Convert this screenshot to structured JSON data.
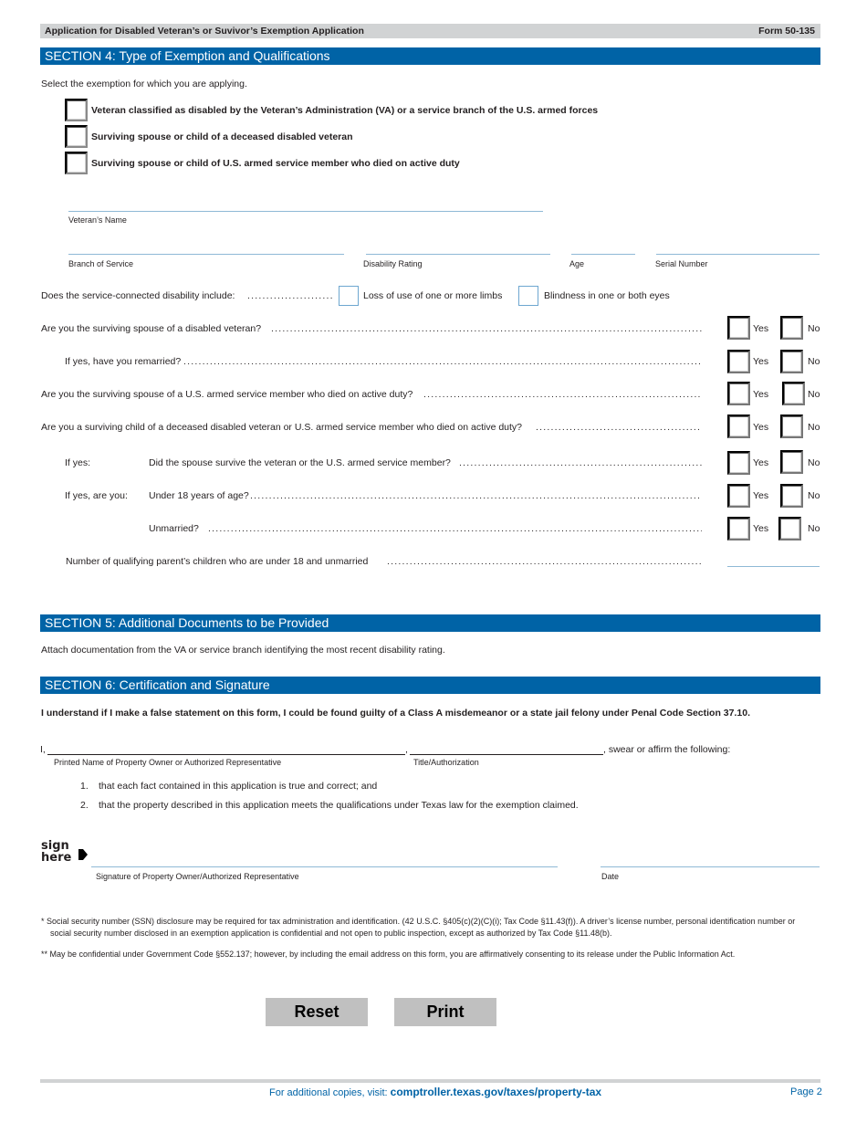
{
  "header": {
    "title": "Application for Disabled Veteran’s or Suvivor’s Exemption Application",
    "form_number": "Form 50-135"
  },
  "section4": {
    "title": "SECTION 4: Type of Exemption and Qualifications",
    "instruction": "Select the exemption for which you are applying.",
    "exemption_options": [
      {
        "label": "Veteran classified as disabled by the Veteran’s Administration (VA) or a service branch of the U.S. armed forces",
        "checked": false
      },
      {
        "label": "Surviving spouse or child of a deceased disabled veteran",
        "checked": false
      },
      {
        "label": "Surviving spouse or child of U.S. armed service member who died on active duty",
        "checked": false
      }
    ],
    "fields": {
      "veterans_name": {
        "label": "Veteran’s Name",
        "value": ""
      },
      "branch_of_service": {
        "label": "Branch of Service",
        "value": ""
      },
      "disability_rating": {
        "label": "Disability Rating",
        "value": ""
      },
      "age": {
        "label": "Age",
        "value": ""
      },
      "serial_number": {
        "label": "Serial Number",
        "value": ""
      }
    },
    "disability_question": {
      "label": "Does the service-connected disability include:",
      "options": [
        {
          "label": "Loss of use of one or more limbs",
          "checked": false
        },
        {
          "label": "Blindness in one or both eyes",
          "checked": false
        }
      ]
    },
    "yes_label": "Yes",
    "no_label": "No",
    "questions": [
      {
        "prefix": "",
        "label": "Are you the surviving spouse of a disabled veteran?",
        "answer": null
      },
      {
        "prefix": "",
        "label": "If yes, have you remarried?",
        "answer": null
      },
      {
        "prefix": "",
        "label": "Are you the surviving spouse of a U.S. armed service member who died on active duty?",
        "answer": null
      },
      {
        "prefix": "",
        "label": "Are you a surviving child of a deceased disabled veteran or U.S. armed service member who died on active duty?",
        "answer": null
      },
      {
        "prefix": "If yes:",
        "label": "Did the spouse survive the veteran or the U.S. armed service member?",
        "answer": null
      },
      {
        "prefix": "If yes, are you:",
        "label": "Under 18 years of age?",
        "answer": null
      },
      {
        "prefix": "",
        "label": "Unmarried?",
        "answer": null
      }
    ],
    "children_count": {
      "label": "Number of qualifying parent’s children who are under 18 and unmarried",
      "value": ""
    }
  },
  "section5": {
    "title": "SECTION 5: Additional Documents to be Provided",
    "text": "Attach documentation from the VA or service branch identifying the most recent disability rating."
  },
  "section6": {
    "title": "SECTION 6: Certification and Signature",
    "warning": "I understand if I make a false statement on this form, I could be found guilty of a Class A misdemeanor or a state jail felony under Penal Code Section 37.10.",
    "i_prefix": "I,",
    "comma": ",",
    "swear_text": ", swear or affirm the following:",
    "printed_name": {
      "label": "Printed Name of Property Owner or Authorized Representative",
      "value": ""
    },
    "title_authorization": {
      "label": "Title/Authorization",
      "value": ""
    },
    "statements": [
      {
        "num": "1.",
        "text": "that each fact contained in this application is true and correct; and"
      },
      {
        "num": "2.",
        "text": "that the property described in this application meets the qualifications under Texas law for the exemption claimed."
      }
    ],
    "sign_here": [
      "sign",
      "here"
    ],
    "signature": {
      "label": "Signature of Property Owner/Authorized Representative",
      "value": ""
    },
    "date": {
      "label": "Date",
      "value": ""
    }
  },
  "footnotes": {
    "ssn_line1": "* Social security number (SSN) disclosure may be required for tax administration and identification. (42 U.S.C. §405(c)(2)(C)(i); Tax Code §11.43(f)). A driver’s license number, personal identification number or",
    "ssn_line2": "social security number disclosed in an exemption application is confidential and not open to public inspection, except as authorized by Tax Code §11.48(b).",
    "email": "** May be confidential under Government Code §552.137; however, by including the email address on this form, you are affirmatively consenting to its release under the Public Information Act."
  },
  "buttons": {
    "reset": "Reset",
    "print": "Print"
  },
  "footer": {
    "copies_text": "For additional copies, visit: ",
    "url": "comptroller.texas.gov/taxes/property-tax",
    "page": "Page 2"
  },
  "colors": {
    "section_header": "#0063a6",
    "top_bar": "#d1d3d4",
    "field_line": "#8fb9d6",
    "button": "#c0c0c0"
  }
}
